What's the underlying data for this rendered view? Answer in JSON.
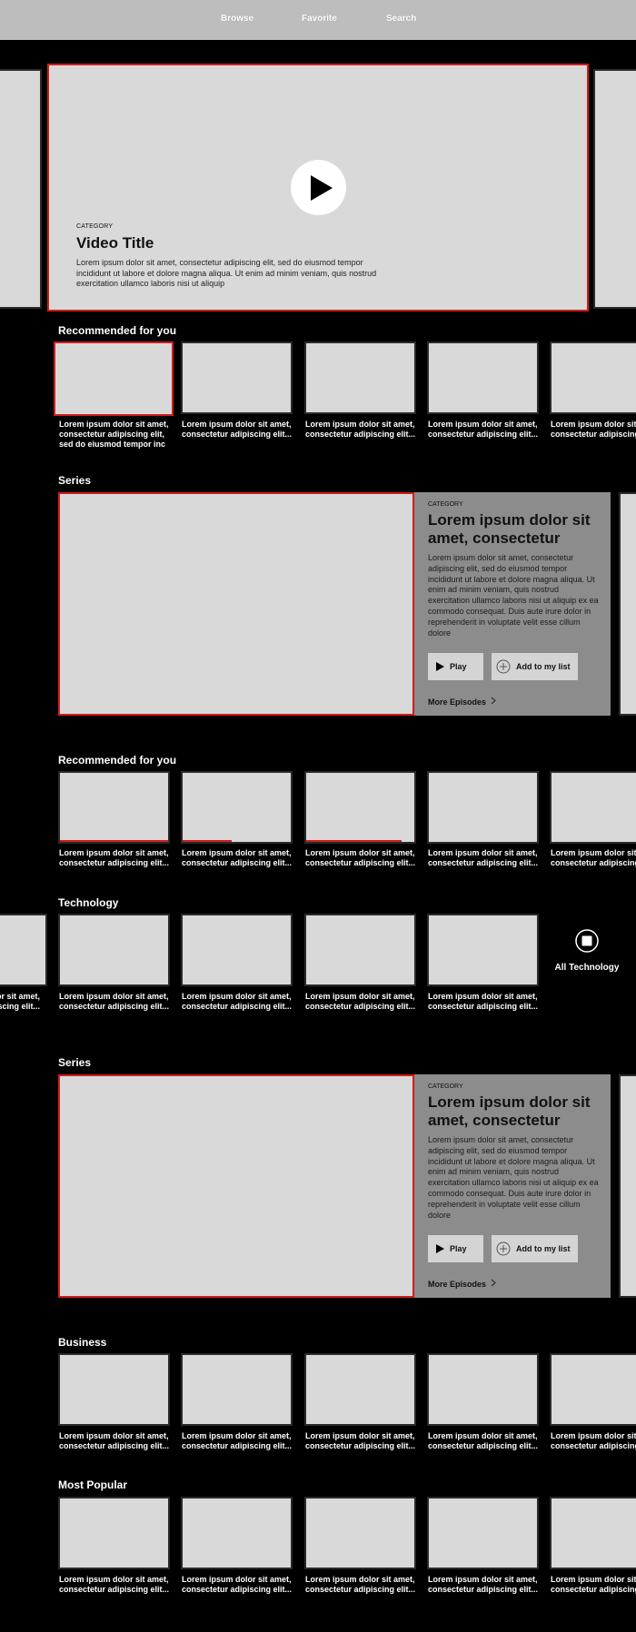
{
  "nav": {
    "items": [
      "Browse",
      "Favorite",
      "Search"
    ]
  },
  "hero": {
    "category": "CATEGORY",
    "title": "Video Title",
    "description": "Lorem ipsum dolor sit amet, consectetur adipiscing elit, sed do eiusmod tempor incididunt ut labore et dolore magna aliqua. Ut enim ad minim veniam, quis nostrud exercitation ullamco laboris nisi ut aliquip"
  },
  "rows": {
    "recommended1": {
      "title": "Recommended for you",
      "first_caption": "Lorem ipsum dolor sit amet, consectetur adipiscing elit, sed do eiusmod tempor inc",
      "caption": "Lorem ipsum dolor sit amet, consectetur adipiscing elit..."
    },
    "recommended2": {
      "title": "Recommended for you",
      "caption": "Lorem ipsum dolor sit amet, consectetur adipiscing elit...",
      "progress": [
        1.0,
        0.45,
        0.88
      ]
    },
    "technology": {
      "title": "Technology",
      "caption": "Lorem ipsum dolor sit amet, consectetur adipiscing elit...",
      "all_label": "All Technology"
    },
    "business": {
      "title": "Business",
      "caption": "Lorem ipsum dolor sit amet, consectetur adipiscing elit..."
    },
    "popular": {
      "title": "Most Popular",
      "caption": "Lorem ipsum dolor sit amet, consectetur adipiscing elit..."
    }
  },
  "series": {
    "section_title": "Series",
    "category": "CATEGORY",
    "title": "Lorem ipsum dolor sit amet, consectetur",
    "description": "Lorem ipsum dolor sit amet, consectetur adipiscing elit, sed do eiusmod tempor incididunt ut labore et dolore magna aliqua. Ut enim ad minim veniam, quis nostrud exercitation ullamco laboris nisi ut aliquip ex ea commodo consequat. Duis aute irure dolor in reprehenderit in voluptate velit esse cillum dolore",
    "play_label": "Play",
    "add_label": "Add to my list",
    "more_label": "More Episodes"
  },
  "colors": {
    "accent": "#d01c1c",
    "tile": "#d9d9d9",
    "panel": "#8c8c8c",
    "nav": "#bdbdbd"
  },
  "icons": {
    "play": "play-icon",
    "add": "plus-circle-icon",
    "more": "chevron-right-icon",
    "all": "stop-square-icon"
  }
}
